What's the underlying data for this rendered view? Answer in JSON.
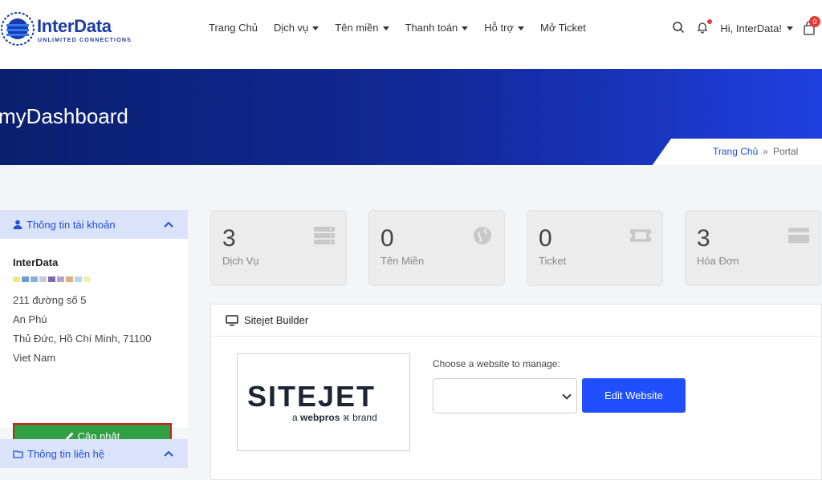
{
  "brand": {
    "name": "InterData",
    "tagline": "UNLIMITED CONNECTIONS",
    "color": "#1b3ca8"
  },
  "nav": {
    "items": [
      {
        "label": "Trang Chủ",
        "dropdown": false
      },
      {
        "label": "Dịch vụ",
        "dropdown": true
      },
      {
        "label": "Tên miền",
        "dropdown": true
      },
      {
        "label": "Thanh toán",
        "dropdown": true
      },
      {
        "label": "Hỗ trợ",
        "dropdown": true
      },
      {
        "label": "Mở Ticket",
        "dropdown": false
      }
    ]
  },
  "header": {
    "greeting": "Hi, InterData!",
    "cart_count": "0"
  },
  "hero": {
    "title": "myDashboard"
  },
  "breadcrumb": {
    "home": "Trang Chủ",
    "separator": "»",
    "current": "Portal"
  },
  "account_panel": {
    "title": "Thông tin tài khoản",
    "name": "InterData",
    "address_lines": [
      "211 đường số 5",
      "An Phú",
      "Thủ Đức, Hồ Chí Minh, 71100",
      "Viet Nam"
    ],
    "update_label": "Cập nhật"
  },
  "contact_panel": {
    "title": "Thông tin liên hệ"
  },
  "stats": [
    {
      "value": "3",
      "label": "Dịch Vụ",
      "icon": "server-icon"
    },
    {
      "value": "0",
      "label": "Tên Miền",
      "icon": "globe-icon"
    },
    {
      "value": "0",
      "label": "Ticket",
      "icon": "ticket-icon"
    },
    {
      "value": "3",
      "label": "Hóa Đơn",
      "icon": "credit-card-icon"
    }
  ],
  "sitejet": {
    "title": "Sitejet Builder",
    "logo_word": "SITEJET",
    "logo_prefix": "a",
    "logo_brand": "webpros",
    "logo_suffix": "brand",
    "choose_label": "Choose a website to manage:",
    "select_value": "",
    "edit_label": "Edit Website"
  },
  "colors": {
    "accent": "#1e4fd8",
    "hero_start": "#0a1f6e",
    "hero_end": "#1e40e0",
    "update_green": "#2ea043",
    "highlight_red": "#d91a1a",
    "edit_blue": "#1f4fff"
  }
}
